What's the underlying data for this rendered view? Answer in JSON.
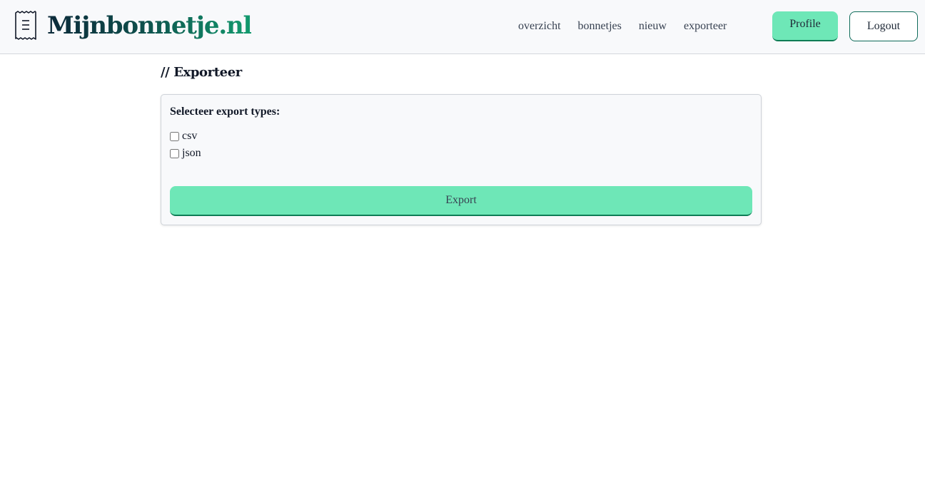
{
  "header": {
    "brand_name": "Mijnbonnetje.nl",
    "brand_icon": "receipt-icon",
    "nav": [
      {
        "label": "overzicht"
      },
      {
        "label": "bonnetjes"
      },
      {
        "label": "nieuw"
      },
      {
        "label": "exporteer"
      }
    ],
    "profile_label": "Profile",
    "logout_label": "Logout"
  },
  "main": {
    "title": "// Exporteer",
    "card": {
      "heading": "Selecteer export types:",
      "options": [
        {
          "label": "csv",
          "checked": false
        },
        {
          "label": "json",
          "checked": false
        }
      ],
      "export_label": "Export"
    }
  },
  "colors": {
    "accent": "#6ee7b7",
    "accent_border": "#0e7c55",
    "header_bg": "#f8f9fb",
    "brand_dark": "#0c2a3a",
    "brand_green": "#129a6e"
  }
}
